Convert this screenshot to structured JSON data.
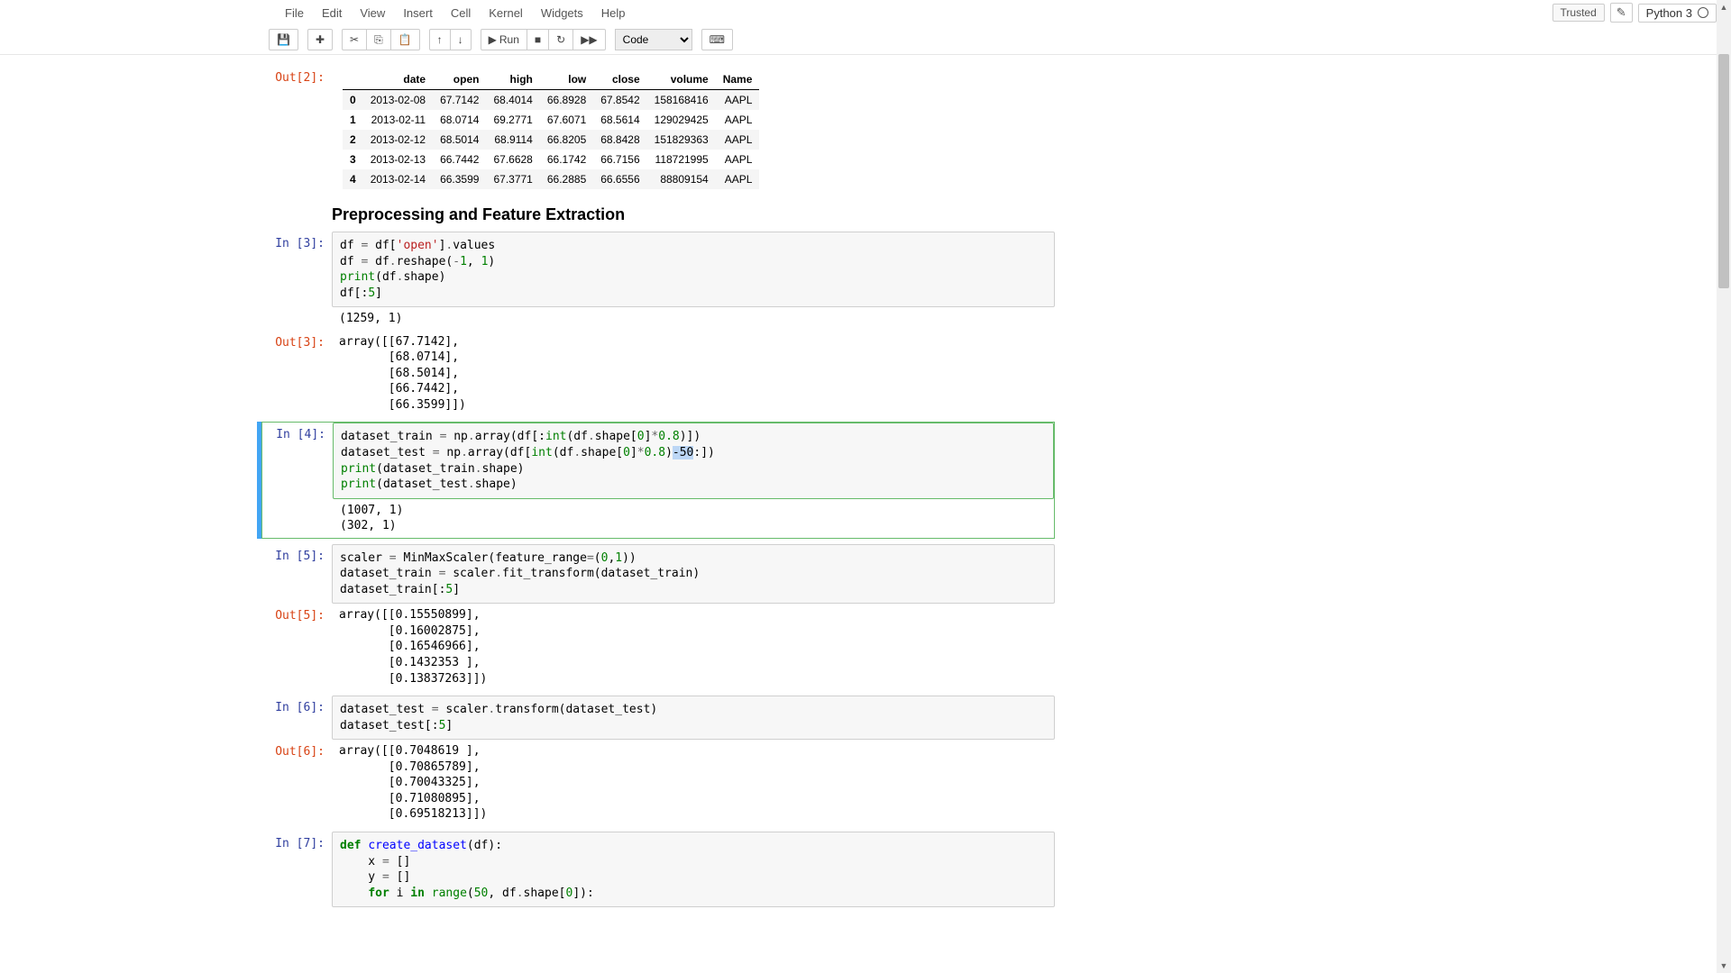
{
  "menu": {
    "file": "File",
    "edit": "Edit",
    "view": "View",
    "insert": "Insert",
    "cell": "Cell",
    "kernel": "Kernel",
    "widgets": "Widgets",
    "help": "Help"
  },
  "header_right": {
    "trusted": "Trusted",
    "kernel": "Python 3"
  },
  "toolbar": {
    "run": "Run",
    "celltype": "Code"
  },
  "out2": {
    "prompt": "Out[2]:",
    "columns": [
      "",
      "date",
      "open",
      "high",
      "low",
      "close",
      "volume",
      "Name"
    ],
    "rows": [
      [
        "0",
        "2013-02-08",
        "67.7142",
        "68.4014",
        "66.8928",
        "67.8542",
        "158168416",
        "AAPL"
      ],
      [
        "1",
        "2013-02-11",
        "68.0714",
        "69.2771",
        "67.6071",
        "68.5614",
        "129029425",
        "AAPL"
      ],
      [
        "2",
        "2013-02-12",
        "68.5014",
        "68.9114",
        "66.8205",
        "68.8428",
        "151829363",
        "AAPL"
      ],
      [
        "3",
        "2013-02-13",
        "66.7442",
        "67.6628",
        "66.1742",
        "66.7156",
        "118721995",
        "AAPL"
      ],
      [
        "4",
        "2013-02-14",
        "66.3599",
        "67.3771",
        "66.2885",
        "66.6556",
        "88809154",
        "AAPL"
      ]
    ]
  },
  "heading1": "Preprocessing and Feature Extraction",
  "cell3": {
    "prompt": "In [3]:",
    "out_prompt": "Out[3]:",
    "print_out": "(1259, 1)",
    "out_val": "array([[67.7142],\n       [68.0714],\n       [68.5014],\n       [66.7442],\n       [66.3599]])"
  },
  "cell4": {
    "prompt": "In [4]:",
    "print_out": "(1007, 1)\n(302, 1)"
  },
  "cell5": {
    "prompt": "In [5]:",
    "out_prompt": "Out[5]:",
    "out_val": "array([[0.15550899],\n       [0.16002875],\n       [0.16546966],\n       [0.1432353 ],\n       [0.13837263]])"
  },
  "cell6": {
    "prompt": "In [6]:",
    "out_prompt": "Out[6]:",
    "out_val": "array([[0.7048619 ],\n       [0.70865789],\n       [0.70043325],\n       [0.71080895],\n       [0.69518213]])"
  },
  "cell7": {
    "prompt": "In [7]:"
  }
}
